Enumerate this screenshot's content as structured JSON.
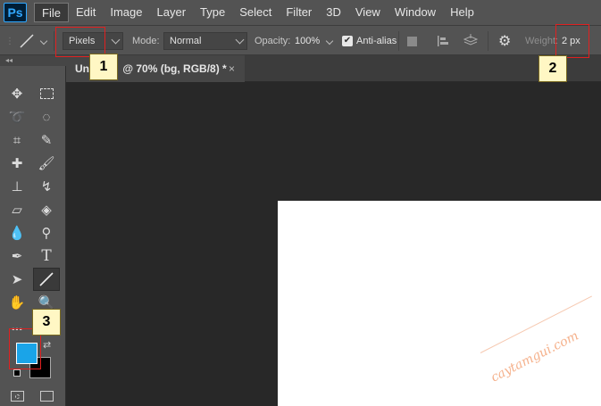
{
  "menubar": {
    "logo": "Ps",
    "items": [
      "File",
      "Edit",
      "Image",
      "Layer",
      "Type",
      "Select",
      "Filter",
      "3D",
      "View",
      "Window",
      "Help"
    ],
    "active": "File"
  },
  "options": {
    "tool_mode": "Pixels",
    "mode_label": "Mode:",
    "mode_value": "Normal",
    "opacity_label": "Opacity:",
    "opacity_value": "100%",
    "antialias_label": "Anti-alias",
    "antialias_checked": true,
    "weight_label": "Weight:",
    "weight_value": "2 px"
  },
  "tab": {
    "title": "Un",
    "title_rest": "@ 70% (bg, RGB/8) *",
    "close": "×"
  },
  "toolbox": {
    "collapse_label": "◂◂",
    "more_label": "..."
  },
  "colors": {
    "foreground": "#1aa4e8",
    "background": "#000000"
  },
  "annotations": [
    "1",
    "2",
    "3"
  ],
  "watermark": "caytamgui.com"
}
